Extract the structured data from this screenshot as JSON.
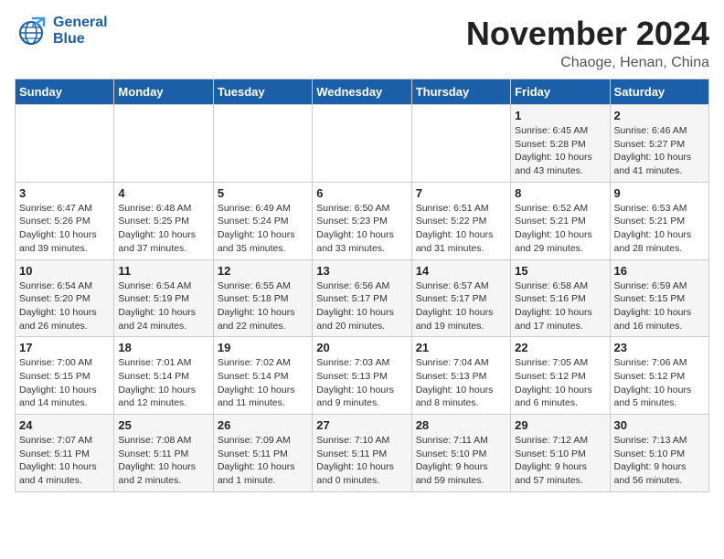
{
  "header": {
    "logo_general": "General",
    "logo_blue": "Blue",
    "month_title": "November 2024",
    "location": "Chaoge, Henan, China"
  },
  "days_of_week": [
    "Sunday",
    "Monday",
    "Tuesday",
    "Wednesday",
    "Thursday",
    "Friday",
    "Saturday"
  ],
  "weeks": [
    [
      {
        "day": "",
        "info": ""
      },
      {
        "day": "",
        "info": ""
      },
      {
        "day": "",
        "info": ""
      },
      {
        "day": "",
        "info": ""
      },
      {
        "day": "",
        "info": ""
      },
      {
        "day": "1",
        "info": "Sunrise: 6:45 AM\nSunset: 5:28 PM\nDaylight: 10 hours\nand 43 minutes."
      },
      {
        "day": "2",
        "info": "Sunrise: 6:46 AM\nSunset: 5:27 PM\nDaylight: 10 hours\nand 41 minutes."
      }
    ],
    [
      {
        "day": "3",
        "info": "Sunrise: 6:47 AM\nSunset: 5:26 PM\nDaylight: 10 hours\nand 39 minutes."
      },
      {
        "day": "4",
        "info": "Sunrise: 6:48 AM\nSunset: 5:25 PM\nDaylight: 10 hours\nand 37 minutes."
      },
      {
        "day": "5",
        "info": "Sunrise: 6:49 AM\nSunset: 5:24 PM\nDaylight: 10 hours\nand 35 minutes."
      },
      {
        "day": "6",
        "info": "Sunrise: 6:50 AM\nSunset: 5:23 PM\nDaylight: 10 hours\nand 33 minutes."
      },
      {
        "day": "7",
        "info": "Sunrise: 6:51 AM\nSunset: 5:22 PM\nDaylight: 10 hours\nand 31 minutes."
      },
      {
        "day": "8",
        "info": "Sunrise: 6:52 AM\nSunset: 5:21 PM\nDaylight: 10 hours\nand 29 minutes."
      },
      {
        "day": "9",
        "info": "Sunrise: 6:53 AM\nSunset: 5:21 PM\nDaylight: 10 hours\nand 28 minutes."
      }
    ],
    [
      {
        "day": "10",
        "info": "Sunrise: 6:54 AM\nSunset: 5:20 PM\nDaylight: 10 hours\nand 26 minutes."
      },
      {
        "day": "11",
        "info": "Sunrise: 6:54 AM\nSunset: 5:19 PM\nDaylight: 10 hours\nand 24 minutes."
      },
      {
        "day": "12",
        "info": "Sunrise: 6:55 AM\nSunset: 5:18 PM\nDaylight: 10 hours\nand 22 minutes."
      },
      {
        "day": "13",
        "info": "Sunrise: 6:56 AM\nSunset: 5:17 PM\nDaylight: 10 hours\nand 20 minutes."
      },
      {
        "day": "14",
        "info": "Sunrise: 6:57 AM\nSunset: 5:17 PM\nDaylight: 10 hours\nand 19 minutes."
      },
      {
        "day": "15",
        "info": "Sunrise: 6:58 AM\nSunset: 5:16 PM\nDaylight: 10 hours\nand 17 minutes."
      },
      {
        "day": "16",
        "info": "Sunrise: 6:59 AM\nSunset: 5:15 PM\nDaylight: 10 hours\nand 16 minutes."
      }
    ],
    [
      {
        "day": "17",
        "info": "Sunrise: 7:00 AM\nSunset: 5:15 PM\nDaylight: 10 hours\nand 14 minutes."
      },
      {
        "day": "18",
        "info": "Sunrise: 7:01 AM\nSunset: 5:14 PM\nDaylight: 10 hours\nand 12 minutes."
      },
      {
        "day": "19",
        "info": "Sunrise: 7:02 AM\nSunset: 5:14 PM\nDaylight: 10 hours\nand 11 minutes."
      },
      {
        "day": "20",
        "info": "Sunrise: 7:03 AM\nSunset: 5:13 PM\nDaylight: 10 hours\nand 9 minutes."
      },
      {
        "day": "21",
        "info": "Sunrise: 7:04 AM\nSunset: 5:13 PM\nDaylight: 10 hours\nand 8 minutes."
      },
      {
        "day": "22",
        "info": "Sunrise: 7:05 AM\nSunset: 5:12 PM\nDaylight: 10 hours\nand 6 minutes."
      },
      {
        "day": "23",
        "info": "Sunrise: 7:06 AM\nSunset: 5:12 PM\nDaylight: 10 hours\nand 5 minutes."
      }
    ],
    [
      {
        "day": "24",
        "info": "Sunrise: 7:07 AM\nSunset: 5:11 PM\nDaylight: 10 hours\nand 4 minutes."
      },
      {
        "day": "25",
        "info": "Sunrise: 7:08 AM\nSunset: 5:11 PM\nDaylight: 10 hours\nand 2 minutes."
      },
      {
        "day": "26",
        "info": "Sunrise: 7:09 AM\nSunset: 5:11 PM\nDaylight: 10 hours\nand 1 minute."
      },
      {
        "day": "27",
        "info": "Sunrise: 7:10 AM\nSunset: 5:11 PM\nDaylight: 10 hours\nand 0 minutes."
      },
      {
        "day": "28",
        "info": "Sunrise: 7:11 AM\nSunset: 5:10 PM\nDaylight: 9 hours\nand 59 minutes."
      },
      {
        "day": "29",
        "info": "Sunrise: 7:12 AM\nSunset: 5:10 PM\nDaylight: 9 hours\nand 57 minutes."
      },
      {
        "day": "30",
        "info": "Sunrise: 7:13 AM\nSunset: 5:10 PM\nDaylight: 9 hours\nand 56 minutes."
      }
    ]
  ]
}
